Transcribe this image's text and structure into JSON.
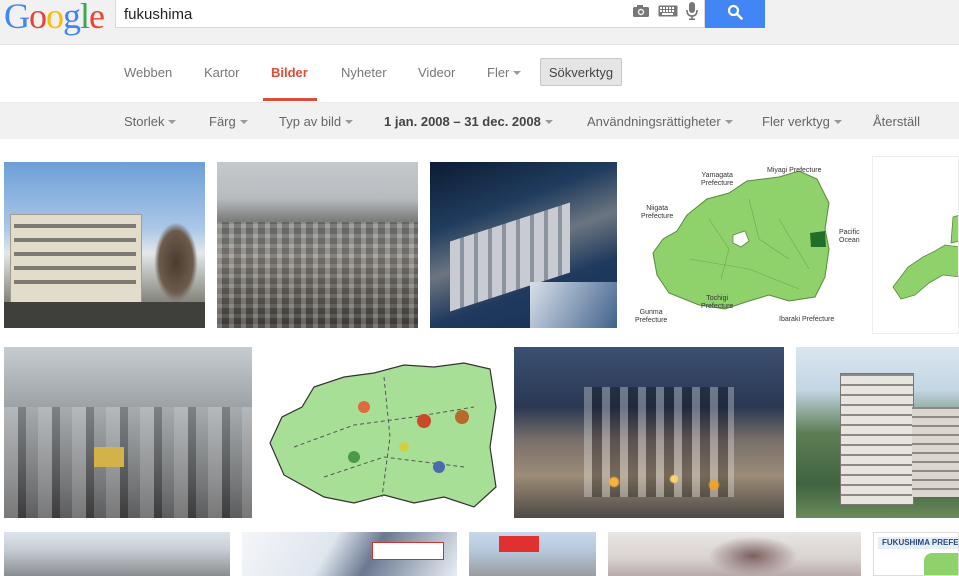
{
  "search": {
    "query": "fukushima"
  },
  "nav": {
    "tabs": [
      {
        "label": "Webben"
      },
      {
        "label": "Kartor"
      },
      {
        "label": "Bilder",
        "active": true
      },
      {
        "label": "Nyheter"
      },
      {
        "label": "Videor"
      },
      {
        "label": "Fler"
      }
    ],
    "tools_label": "Sökverktyg"
  },
  "filters": {
    "size": "Storlek",
    "color": "Färg",
    "type": "Typ av bild",
    "date_range": "1 jan. 2008 – 31 dec. 2008",
    "rights": "Användningsrättigheter",
    "more_tools": "Fler verktyg",
    "reset": "Återställ"
  },
  "prefecture_map": {
    "labels": {
      "yamagata": "Yamagata\nPrefecture",
      "miyagi": "Miyagi Prefecture",
      "niigata": "Niigata\nPrefecture",
      "pacific": "Pacific\nOcean",
      "tochigi": "Tochigi\nPrefecture",
      "gunma": "Gunma\nPrefecture",
      "ibaraki": "Ibaraki Prefecture"
    }
  },
  "banner_fukushima": "FUKUSHIMA PREFE",
  "colors": {
    "search_blue": "#4285f4",
    "active_tab": "#dd4b39",
    "map_green": "#8fd16b"
  }
}
